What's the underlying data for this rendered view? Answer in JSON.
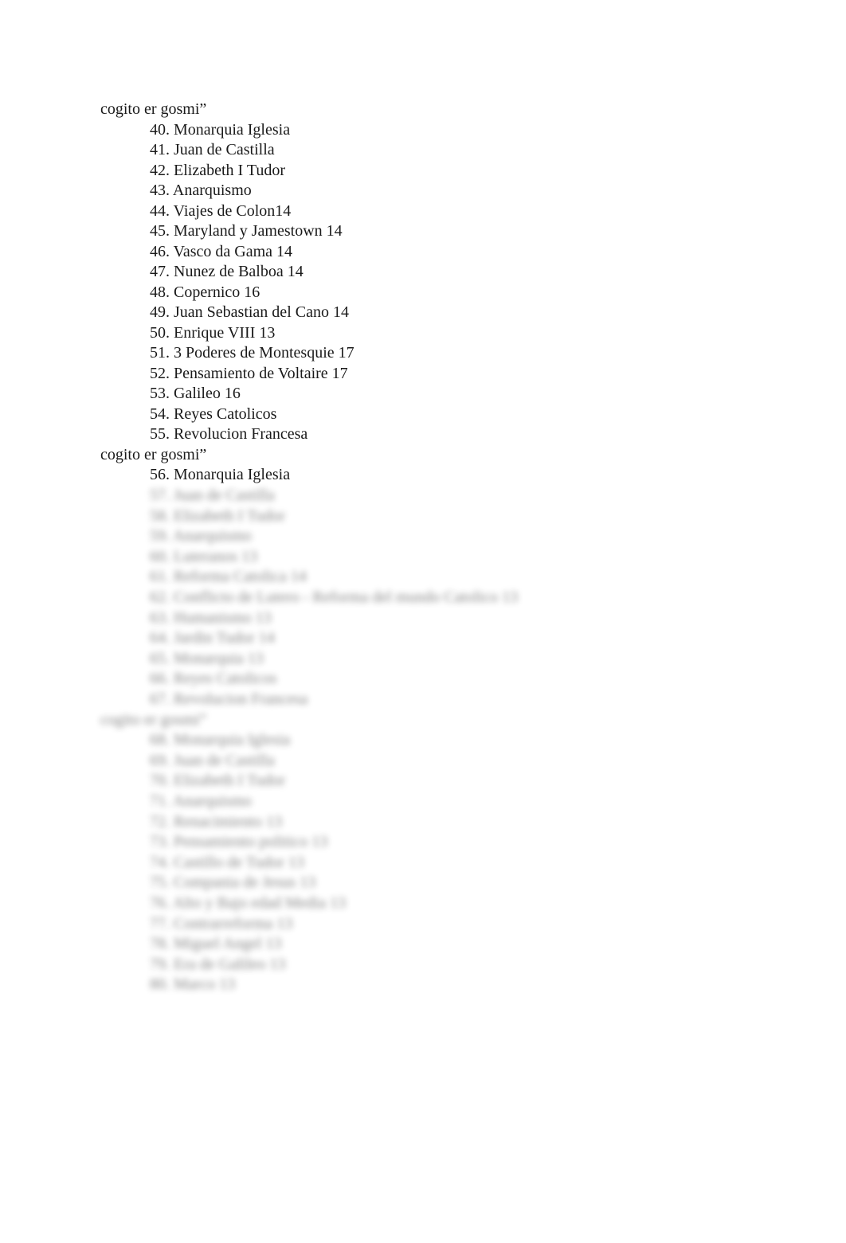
{
  "document": {
    "visible_section": [
      {
        "type": "heading",
        "text": "cogito er gosmi”"
      },
      {
        "type": "item",
        "text": "40. Monarquia Iglesia"
      },
      {
        "type": "item",
        "text": "41. Juan de Castilla"
      },
      {
        "type": "item",
        "text": "42. Elizabeth I Tudor"
      },
      {
        "type": "item",
        "text": "43. Anarquismo"
      },
      {
        "type": "item",
        "text": "44. Viajes de Colon14"
      },
      {
        "type": "item",
        "text": "45. Maryland y Jamestown 14"
      },
      {
        "type": "item",
        "text": "46. Vasco da Gama 14"
      },
      {
        "type": "item",
        "text": "47. Nunez de Balboa 14"
      },
      {
        "type": "item",
        "text": "48. Copernico 16"
      },
      {
        "type": "item",
        "text": "49. Juan Sebastian del Cano 14"
      },
      {
        "type": "item",
        "text": "50. Enrique VIII 13"
      },
      {
        "type": "item",
        "text": "51. 3 Poderes de Montesquie 17"
      },
      {
        "type": "item",
        "text": "52. Pensamiento de Voltaire 17"
      },
      {
        "type": "item",
        "text": "53. Galileo 16"
      },
      {
        "type": "item",
        "text": "54. Reyes Catolicos"
      },
      {
        "type": "item",
        "text": "55. Revolucion Francesa"
      },
      {
        "type": "heading",
        "text": "cogito er gosmi”"
      },
      {
        "type": "item",
        "text": "56. Monarquia Iglesia"
      }
    ],
    "blurred_section": [
      {
        "type": "item",
        "text": "57. Juan de Castilla"
      },
      {
        "type": "item",
        "text": "58. Elizabeth I Tudor"
      },
      {
        "type": "item",
        "text": "59. Anarquismo"
      },
      {
        "type": "item",
        "text": "60. Luteranos 13"
      },
      {
        "type": "item",
        "text": "61. Reforma Catolica 14"
      },
      {
        "type": "item",
        "text": "62. Conflicto de Lutero - Reforma del mundo Catolico 13"
      },
      {
        "type": "item",
        "text": "63. Humanismo 13"
      },
      {
        "type": "item",
        "text": "64. Jardin Tudor 14"
      },
      {
        "type": "item",
        "text": "65. Monarquia 13"
      },
      {
        "type": "item",
        "text": "66. Reyes Catolicos"
      },
      {
        "type": "item",
        "text": "67. Revolucion Francesa"
      },
      {
        "type": "heading",
        "text": "cogito er gosmi”"
      },
      {
        "type": "item",
        "text": "68. Monarquia Iglesia"
      },
      {
        "type": "item",
        "text": "69. Juan de Castilla"
      },
      {
        "type": "item",
        "text": "70. Elizabeth I Tudor"
      },
      {
        "type": "item",
        "text": "71. Anarquismo"
      },
      {
        "type": "item",
        "text": "72. Renacimiento 13"
      },
      {
        "type": "item",
        "text": "73. Pensamiento politico 13"
      },
      {
        "type": "item",
        "text": "74. Castillo de Tudor 13"
      },
      {
        "type": "item",
        "text": "75. Compania de Jesus 13"
      },
      {
        "type": "item",
        "text": "76. Alto y Bajo edad Media 13"
      },
      {
        "type": "item",
        "text": "77. Contrarreforma 13"
      },
      {
        "type": "item",
        "text": "78. Miguel Angel 13"
      },
      {
        "type": "item",
        "text": "79. Era de Galileo 13"
      },
      {
        "type": "item",
        "text": "80. Marco 13"
      }
    ]
  }
}
